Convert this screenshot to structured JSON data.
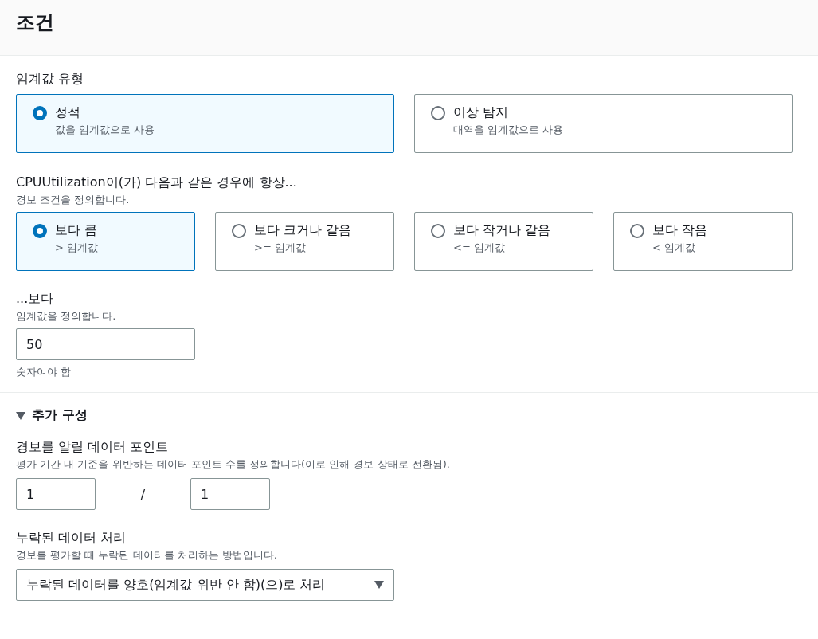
{
  "header": {
    "title": "조건"
  },
  "threshold_type": {
    "label": "임계값 유형",
    "options": [
      {
        "title": "정적",
        "description": "값을 임계값으로 사용",
        "selected": true
      },
      {
        "title": "이상 탐지",
        "description": "대역을 임계값으로 사용",
        "selected": false
      }
    ]
  },
  "condition": {
    "label": "CPUUtilization이(가) 다음과 같은 경우에 항상...",
    "description": "경보 조건을 정의합니다.",
    "options": [
      {
        "title": "보다 큼",
        "description": "> 임계값",
        "selected": true
      },
      {
        "title": "보다 크거나 같음",
        "description": ">= 임계값",
        "selected": false
      },
      {
        "title": "보다 작거나 같음",
        "description": "<= 임계값",
        "selected": false
      },
      {
        "title": "보다 작음",
        "description": "< 임계값",
        "selected": false
      }
    ]
  },
  "threshold": {
    "label": "...보다",
    "description": "임계값을 정의합니다.",
    "value": "50",
    "hint": "숫자여야 함"
  },
  "additional": {
    "title": "추가 구성",
    "expanded": true,
    "datapoints": {
      "label": "경보를 알릴 데이터 포인트",
      "description": "평가 기간 내 기준을 위반하는 데이터 포인트 수를 정의합니다(이로 인해 경보 상태로 전환됨).",
      "value_1": "1",
      "separator": "/",
      "value_2": "1"
    },
    "missing_data": {
      "label": "누락된 데이터 처리",
      "description": "경보를 평가할 때 누락된 데이터를 처리하는 방법입니다.",
      "value": "누락된 데이터를 양호(임계값 위반 안 함)(으)로 처리"
    }
  }
}
